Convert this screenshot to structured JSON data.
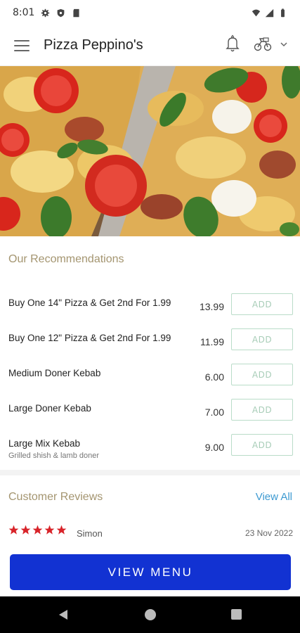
{
  "status_bar": {
    "time": "8:01",
    "icons": [
      "gear-icon",
      "shield-icon",
      "sd-card-icon",
      "wifi-icon",
      "signal-icon",
      "battery-icon"
    ]
  },
  "app_bar": {
    "title": "Pizza Peppino's",
    "icons": [
      "menu-icon",
      "bell-icon",
      "delivery-bike-icon",
      "chevron-down-icon"
    ]
  },
  "hero": {
    "image": "pizza-photo"
  },
  "recommendations": {
    "title": "Our Recommendations",
    "add_label": "ADD",
    "items": [
      {
        "name": "Buy One 14\" Pizza & Get 2nd For 1.99",
        "price": "13.99",
        "subtitle": ""
      },
      {
        "name": "Buy One 12\" Pizza & Get 2nd For 1.99",
        "price": "11.99",
        "subtitle": ""
      },
      {
        "name": "Medium Doner Kebab",
        "price": "6.00",
        "subtitle": ""
      },
      {
        "name": "Large Doner Kebab",
        "price": "7.00",
        "subtitle": ""
      },
      {
        "name": "Large Mix Kebab",
        "price": "9.00",
        "subtitle": "Grilled shish & lamb doner"
      }
    ]
  },
  "reviews": {
    "title": "Customer Reviews",
    "view_all": "View All",
    "items": [
      {
        "rating": 5,
        "name": "Simon",
        "date": "23 Nov 2022"
      }
    ]
  },
  "cta": {
    "label": "VIEW MENU"
  },
  "colors": {
    "accent": "#1232d2",
    "section_title": "#a49570",
    "link": "#3d9ad1",
    "star": "#d8242a",
    "add_border": "#b9dcc8"
  }
}
